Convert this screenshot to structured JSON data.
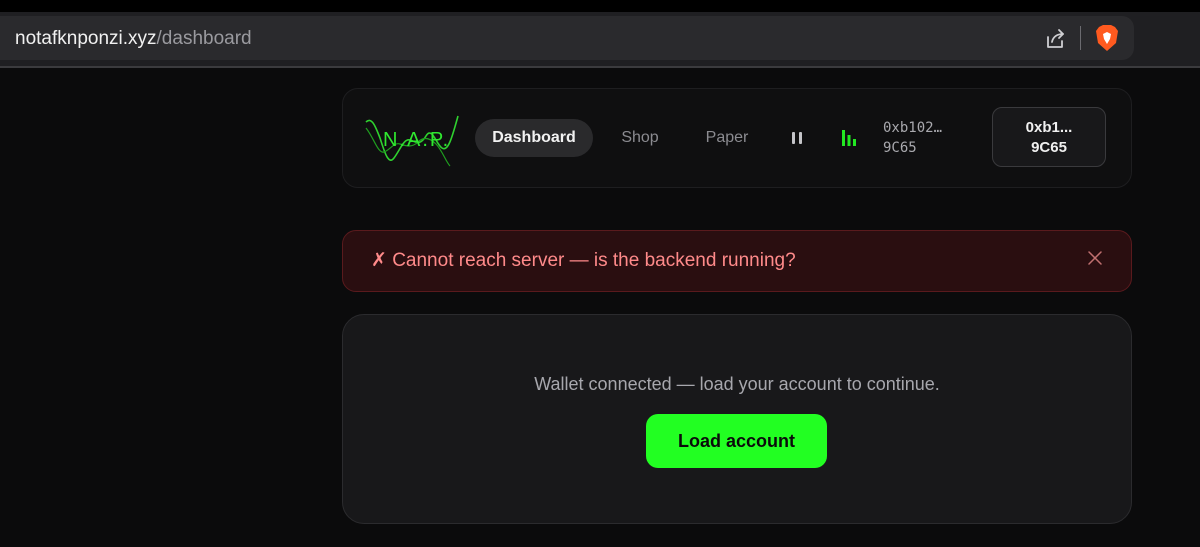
{
  "browser": {
    "url_host": "notafknponzi.xyz",
    "url_path": "/dashboard"
  },
  "nav": {
    "logo_text": "N.A.P.",
    "tabs": [
      {
        "label": "Dashboard",
        "active": true
      },
      {
        "label": "Shop",
        "active": false
      },
      {
        "label": "Paper",
        "active": false
      }
    ],
    "wallet_short": {
      "line1": "0xb102…",
      "line2": "9C65"
    },
    "wallet_button": {
      "line1": "0xb1...",
      "line2": "9C65"
    }
  },
  "error": {
    "message": "✗ Cannot reach server — is the backend running?"
  },
  "card": {
    "message": "Wallet connected — load your account to continue.",
    "button_label": "Load account"
  },
  "colors": {
    "accent_green": "#22ff22",
    "error_text": "#ff8a8a",
    "background": "#0b0b0c"
  },
  "icons": [
    "share-icon",
    "brave-shield-icon",
    "pause-icon",
    "equalizer-bars-icon",
    "close-icon"
  ]
}
